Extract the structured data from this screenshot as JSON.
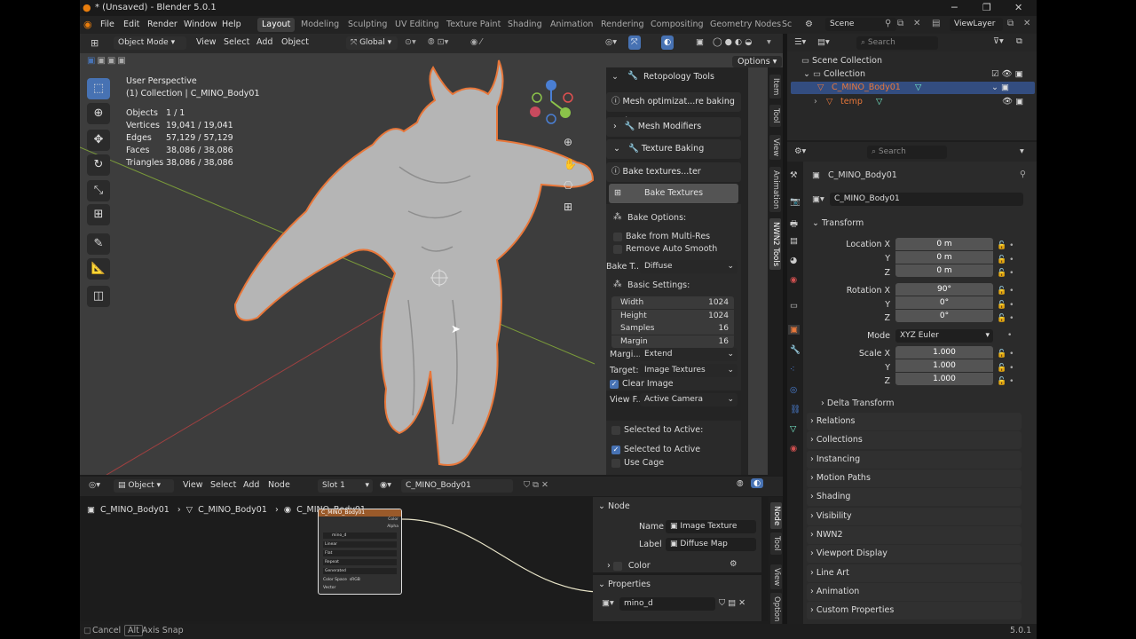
{
  "window": {
    "title": "* (Unsaved) - Blender 5.0.1",
    "minimize": "─",
    "maximize": "❐",
    "close": "✕"
  },
  "menu": {
    "items": [
      "File",
      "Edit",
      "Render",
      "Window",
      "Help"
    ],
    "workspaces": [
      "Layout",
      "Modeling",
      "Sculpting",
      "UV Editing",
      "Texture Paint",
      "Shading",
      "Animation",
      "Rendering",
      "Compositing",
      "Geometry Nodes",
      "Sc"
    ],
    "scene": "Scene",
    "view_layer": "ViewLayer"
  },
  "viewport": {
    "mode": "Object Mode",
    "menus": [
      "View",
      "Select",
      "Add",
      "Object"
    ],
    "orientation": "Global",
    "options": "Options",
    "perspective": "User Perspective",
    "collection_path": "(1) Collection | C_MINO_Body01",
    "stats": [
      {
        "label": "Objects",
        "value": "1 / 1"
      },
      {
        "label": "Vertices",
        "value": "19,041 / 19,041"
      },
      {
        "label": "Edges",
        "value": "57,129 / 57,129"
      },
      {
        "label": "Faces",
        "value": "38,086 / 38,086"
      },
      {
        "label": "Triangles",
        "value": "38,086 / 38,086"
      }
    ]
  },
  "npanel": {
    "header": "Retopology Tools",
    "info1": "Mesh optimizat...re baking tools",
    "mesh_modifiers": "Mesh Modifiers",
    "texture_baking": "Texture Baking",
    "info2": "Bake textures...ter retopology",
    "bake_button": "Bake Textures",
    "bake_options": "Bake Options:",
    "bake_multires": "Bake from Multi-Res",
    "remove_smooth": "Remove Auto Smooth",
    "bake_type_label": "Bake T...",
    "bake_type": "Diffuse",
    "basic_settings": "Basic Settings:",
    "numfields": [
      {
        "label": "Width",
        "value": "1024"
      },
      {
        "label": "Height",
        "value": "1024"
      },
      {
        "label": "Samples",
        "value": "16"
      },
      {
        "label": "Margin",
        "value": "16"
      }
    ],
    "margin_type_label": "Margi...",
    "margin_type": "Extend",
    "target_label": "Target:",
    "target": "Image Textures",
    "clear_image": "Clear Image",
    "view_from_label": "View F...",
    "view_from": "Active Camera",
    "selected_active_hdr": "Selected to Active:",
    "selected_active": "Selected to Active",
    "use_cage": "Use Cage",
    "tabs": [
      "Item",
      "Tool",
      "View",
      "Animation",
      "NWN2 Tools"
    ]
  },
  "node_editor": {
    "type": "Object",
    "menus": [
      "View",
      "Select",
      "Add",
      "Node"
    ],
    "slot": "Slot 1",
    "material": "C_MINO_Body01",
    "breadcrumb": [
      "C_MINO_Body01",
      "C_MINO_Body01",
      "C_MINO_Body01"
    ],
    "node_title": "C_MINO_Body01",
    "node_rows": [
      "mino_d",
      "Linear",
      "Flat",
      "Repeat",
      "Generated",
      "sRGB"
    ],
    "node_color_space_label": "Color Space",
    "node_vector": "Vector",
    "node_out_color": "Color",
    "node_out_alpha": "Alpha",
    "side": {
      "node_hdr": "Node",
      "name_label": "Name",
      "name": "Image Texture",
      "label_label": "Label",
      "label": "Diffuse Map",
      "color": "Color",
      "properties": "Properties",
      "image": "mino_d",
      "tabs": [
        "Node",
        "Tool",
        "View",
        "Option"
      ]
    }
  },
  "outliner": {
    "search": "Search",
    "items": [
      {
        "label": "Scene Collection"
      },
      {
        "label": "Collection"
      },
      {
        "label": "C_MINO_Body01"
      },
      {
        "label": "temp"
      }
    ]
  },
  "properties": {
    "search": "Search",
    "object": "C_MINO_Body01",
    "object_name": "C_MINO_Body01",
    "transform": "Transform",
    "location_label": "Location X",
    "loc": [
      "0 m",
      "0 m",
      "0 m"
    ],
    "rotation_label": "Rotation X",
    "rot": [
      "90°",
      "0°",
      "0°"
    ],
    "mode_label": "Mode",
    "mode": "XYZ Euler",
    "scale_label": "Scale X",
    "scale": [
      "1.000",
      "1.000",
      "1.000"
    ],
    "axis_y": "Y",
    "axis_z": "Z",
    "delta": "Delta Transform",
    "sections": [
      "Relations",
      "Collections",
      "Instancing",
      "Motion Paths",
      "Shading",
      "Visibility",
      "NWN2",
      "Viewport Display",
      "Line Art",
      "Animation",
      "Custom Properties"
    ]
  },
  "status": {
    "cancel": "Cancel",
    "alt": "Alt",
    "axis_snap": "Axis Snap",
    "version": "5.0.1"
  },
  "colors": {
    "accent": "#4772b3",
    "selection_outline": "#e8773a",
    "active_row": "#334d80"
  }
}
